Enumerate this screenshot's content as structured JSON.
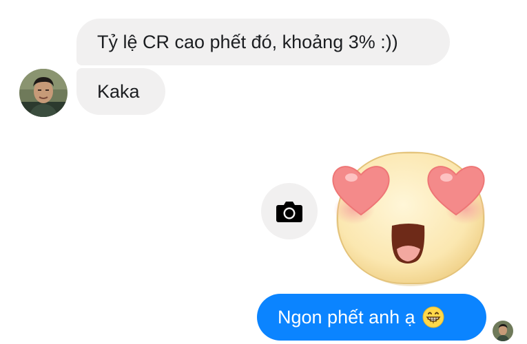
{
  "conversation": {
    "messages": [
      {
        "direction": "incoming",
        "text": "Tỷ lệ CR cao phết đó, khoảng 3% :))"
      },
      {
        "direction": "incoming",
        "text": "Kaka"
      },
      {
        "direction": "outgoing",
        "type": "sticker",
        "sticker_icon": "heart-eyes-face-icon"
      },
      {
        "direction": "outgoing",
        "text": "Ngon phết anh ạ",
        "emoji_icon": "grinning-face-icon"
      }
    ],
    "camera_button_icon": "camera-icon"
  },
  "colors": {
    "incoming_bubble": "#f1f0f0",
    "outgoing_bubble": "#0b84ff",
    "incoming_text": "#1c1e21",
    "outgoing_text": "#ffffff"
  }
}
